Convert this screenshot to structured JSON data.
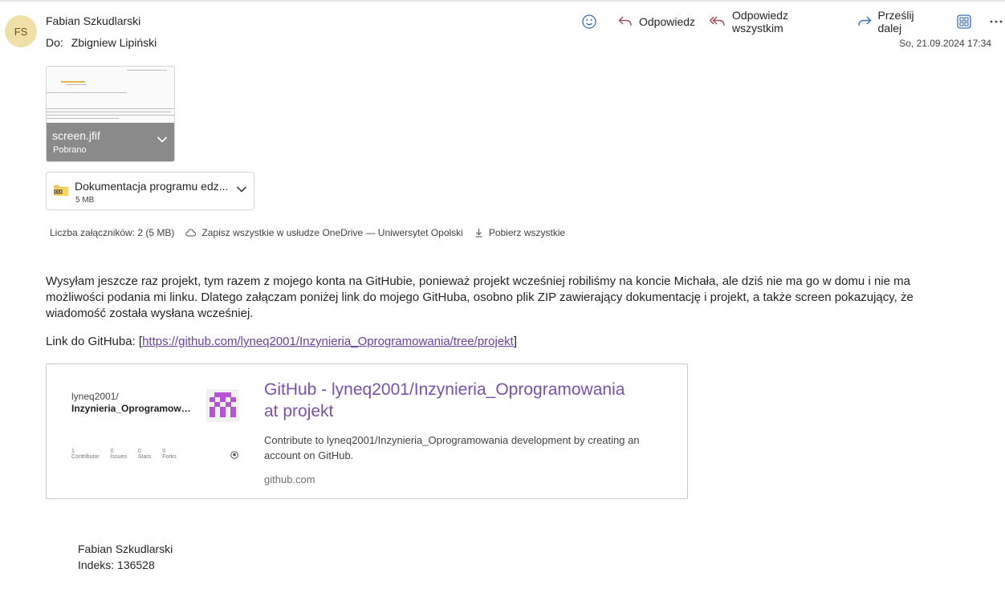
{
  "header": {
    "avatar_initials": "FS",
    "sender_name": "Fabian Szkudlarski",
    "to_label": "Do:",
    "to_name": "Zbigniew Lipiński",
    "date": "So, 21.09.2024 17:34",
    "actions": {
      "reply": "Odpowiedz",
      "reply_all": "Odpowiedz wszystkim",
      "forward": "Prześlij dalej"
    }
  },
  "attachments": [
    {
      "name": "screen.jfif",
      "status": "Pobrano"
    },
    {
      "name": "Dokumentacja programu edz...",
      "size": "5 MB"
    }
  ],
  "attachment_bar": {
    "count": "Liczba załączników: 2 (5 MB)",
    "save_onedrive": "Zapisz wszystkie w usłudze OneDrive — Uniwersytet Opolski",
    "download_all": "Pobierz wszystkie"
  },
  "body": {
    "paragraph": "Wysyłam jeszcze raz projekt, tym razem z mojego konta na GitHubie, ponieważ projekt wcześniej robiliśmy na koncie Michała, ale dziś nie ma go w domu i nie ma możliwości podania mi linku. Dlatego załączam poniżej link do mojego GitHuba, osobno plik ZIP zawierający dokumentację i projekt, a także screen pokazujący, że wiadomość została wysłana wcześniej.",
    "link_prefix": "Link do GitHuba: [",
    "link_url": "https://github.com/lyneq2001/Inzynieria_Oprogramowania/tree/projekt",
    "link_suffix": "]"
  },
  "link_card": {
    "repo_owner": "lyneq2001/",
    "repo_name": "Inzynieria_Oprogramowania",
    "stats": [
      {
        "value": "1",
        "label": "Contributor"
      },
      {
        "value": "0",
        "label": "Issues"
      },
      {
        "value": "0",
        "label": "Stars"
      },
      {
        "value": "0",
        "label": "Forks"
      }
    ],
    "title": "GitHub - lyneq2001/Inzynieria_Oprogramowania at projekt",
    "description": "Contribute to lyneq2001/Inzynieria_Oprogramowania development by creating an account on GitHub.",
    "domain": "github.com"
  },
  "signature": {
    "name": "Fabian Szkudlarski",
    "index": "Indeks: 136528"
  }
}
